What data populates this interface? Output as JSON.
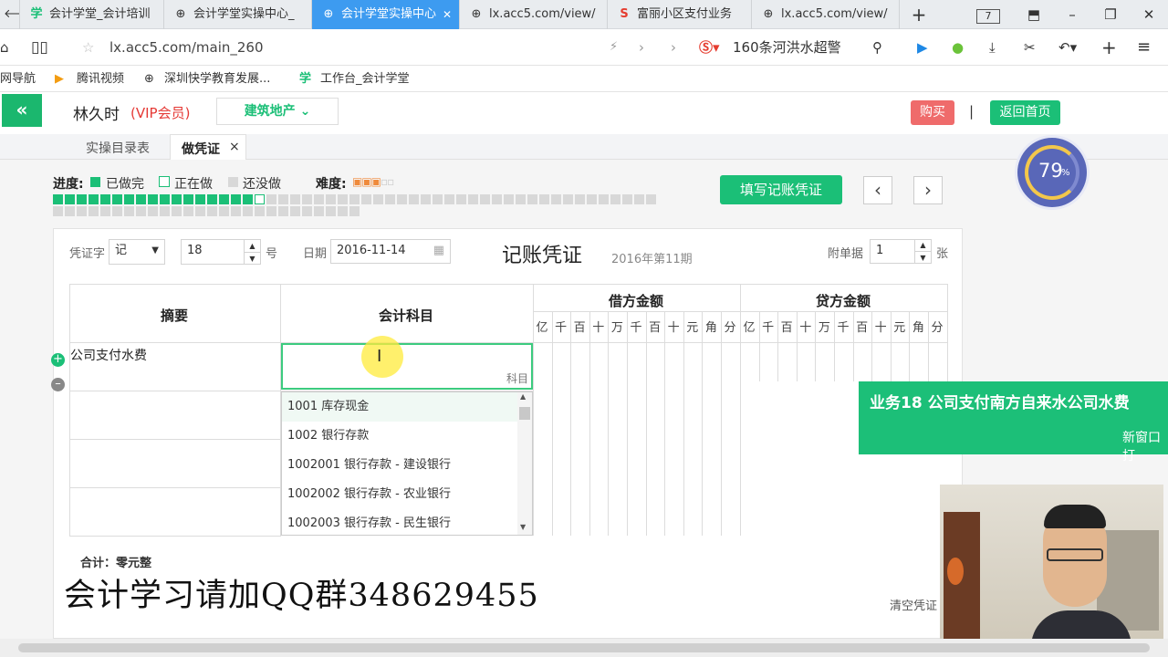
{
  "browser": {
    "tabs": [
      {
        "label": "会计学堂_会计培训",
        "icon": "xue-icon"
      },
      {
        "label": "会计学堂实操中心_",
        "icon": "globe-icon"
      },
      {
        "label": "会计学堂实操中心",
        "icon": "globe-icon",
        "active": true
      },
      {
        "label": "lx.acc5.com/view/",
        "icon": "globe-icon"
      },
      {
        "label": "富丽小区支付业务",
        "icon": "sogou-icon"
      },
      {
        "label": "lx.acc5.com/view/",
        "icon": "globe-icon"
      }
    ],
    "tab_count": "7",
    "url": "lx.acc5.com/main_260",
    "search_text": "160条河洪水超警",
    "bookmarks": [
      "网导航",
      "腾讯视频",
      "深圳快学教育发展...",
      "工作台_会计学堂"
    ]
  },
  "header": {
    "user_name": "林久时",
    "vip_label": "(VIP会员)",
    "industry": "建筑地产",
    "buy_label": "购买",
    "separator": "|",
    "home_label": "返回首页"
  },
  "page_tabs": [
    {
      "label": "实操目录表"
    },
    {
      "label": "做凭证",
      "close": "×"
    }
  ],
  "progress": {
    "title": "进度:",
    "done_label": "已做完",
    "doing_label": "正在做",
    "todo_label": "还没做",
    "difficulty_label": "难度:",
    "done_count": 17,
    "current_index": 18,
    "total": 77,
    "fill_voucher_label": "填写记账凭证",
    "prev": "‹",
    "next": "›",
    "percent": "79",
    "percent_sign": "%",
    "colors": {
      "done": "#1bbf77",
      "todo": "#d8d8d8"
    }
  },
  "voucher": {
    "type_label": "凭证字",
    "type_value": "记",
    "number_value": "18",
    "number_unit": "号",
    "date_label": "日期",
    "date_value": "2016-11-14",
    "title": "记账凭证",
    "period": "2016年第11期",
    "attach_label": "附单据",
    "attach_value": "1",
    "attach_unit": "张",
    "col_summary": "摘要",
    "col_subject": "会计科目",
    "col_debit": "借方金额",
    "col_credit": "贷方金额",
    "digits": [
      "亿",
      "千",
      "百",
      "十",
      "万",
      "千",
      "百",
      "十",
      "元",
      "角",
      "分"
    ],
    "row1_summary": "公司支付水费",
    "subject_hint": "科目",
    "total_label": "合计：零元整",
    "clear_label": "清空凭证"
  },
  "dropdown": [
    "1001 库存现金",
    "1002 银行存款",
    "1002001 银行存款 - 建设银行",
    "1002002 银行存款 - 农业银行",
    "1002003 银行存款 - 民生银行"
  ],
  "notice": {
    "title": "业务18 公司支付南方自来水公司水费",
    "link": "新窗口打"
  },
  "overlay_text": "会计学习请加QQ群348629455"
}
